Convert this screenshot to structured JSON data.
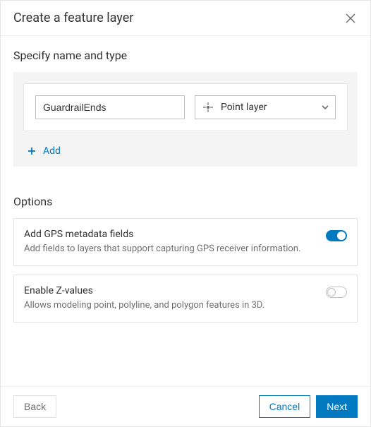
{
  "dialog": {
    "title": "Create a feature layer"
  },
  "specify": {
    "heading": "Specify name and type",
    "layer_name_value": "GuardrailEnds",
    "layer_type_label": "Point layer",
    "add_label": "Add"
  },
  "options": {
    "heading": "Options",
    "items": [
      {
        "title": "Add GPS metadata fields",
        "desc": "Add fields to layers that support capturing GPS receiver information.",
        "on": true
      },
      {
        "title": "Enable Z-values",
        "desc": "Allows modeling point, polyline, and polygon features in 3D.",
        "on": false
      }
    ]
  },
  "footer": {
    "back": "Back",
    "cancel": "Cancel",
    "next": "Next"
  }
}
